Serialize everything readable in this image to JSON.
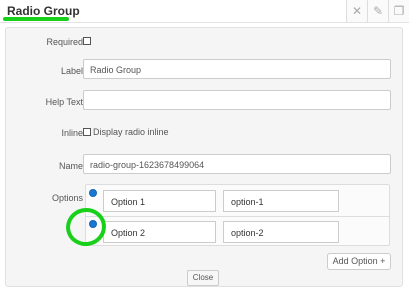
{
  "header": {
    "title": "Radio Group",
    "actions": [
      {
        "name": "close-icon",
        "glyph": "✕"
      },
      {
        "name": "edit-icon",
        "glyph": "✎"
      },
      {
        "name": "copy-icon",
        "glyph": "❐"
      }
    ],
    "accent_color": "#18d01a"
  },
  "form": {
    "required_label": "Required",
    "required_checked": false,
    "label_label": "Label",
    "label_value": "Radio Group",
    "help_text_label": "Help Text",
    "help_text_value": "",
    "inline_label": "Inline",
    "inline_checkbox_text": "Display radio inline",
    "inline_checked": false,
    "name_label": "Name",
    "name_value": "radio-group-1623678499064",
    "options_label": "Options",
    "options": [
      {
        "label": "Option 1",
        "value": "option-1",
        "selected": true
      },
      {
        "label": "Option 2",
        "value": "option-2",
        "selected": true
      }
    ],
    "add_option_label": "Add Option +",
    "close_label": "Close"
  }
}
